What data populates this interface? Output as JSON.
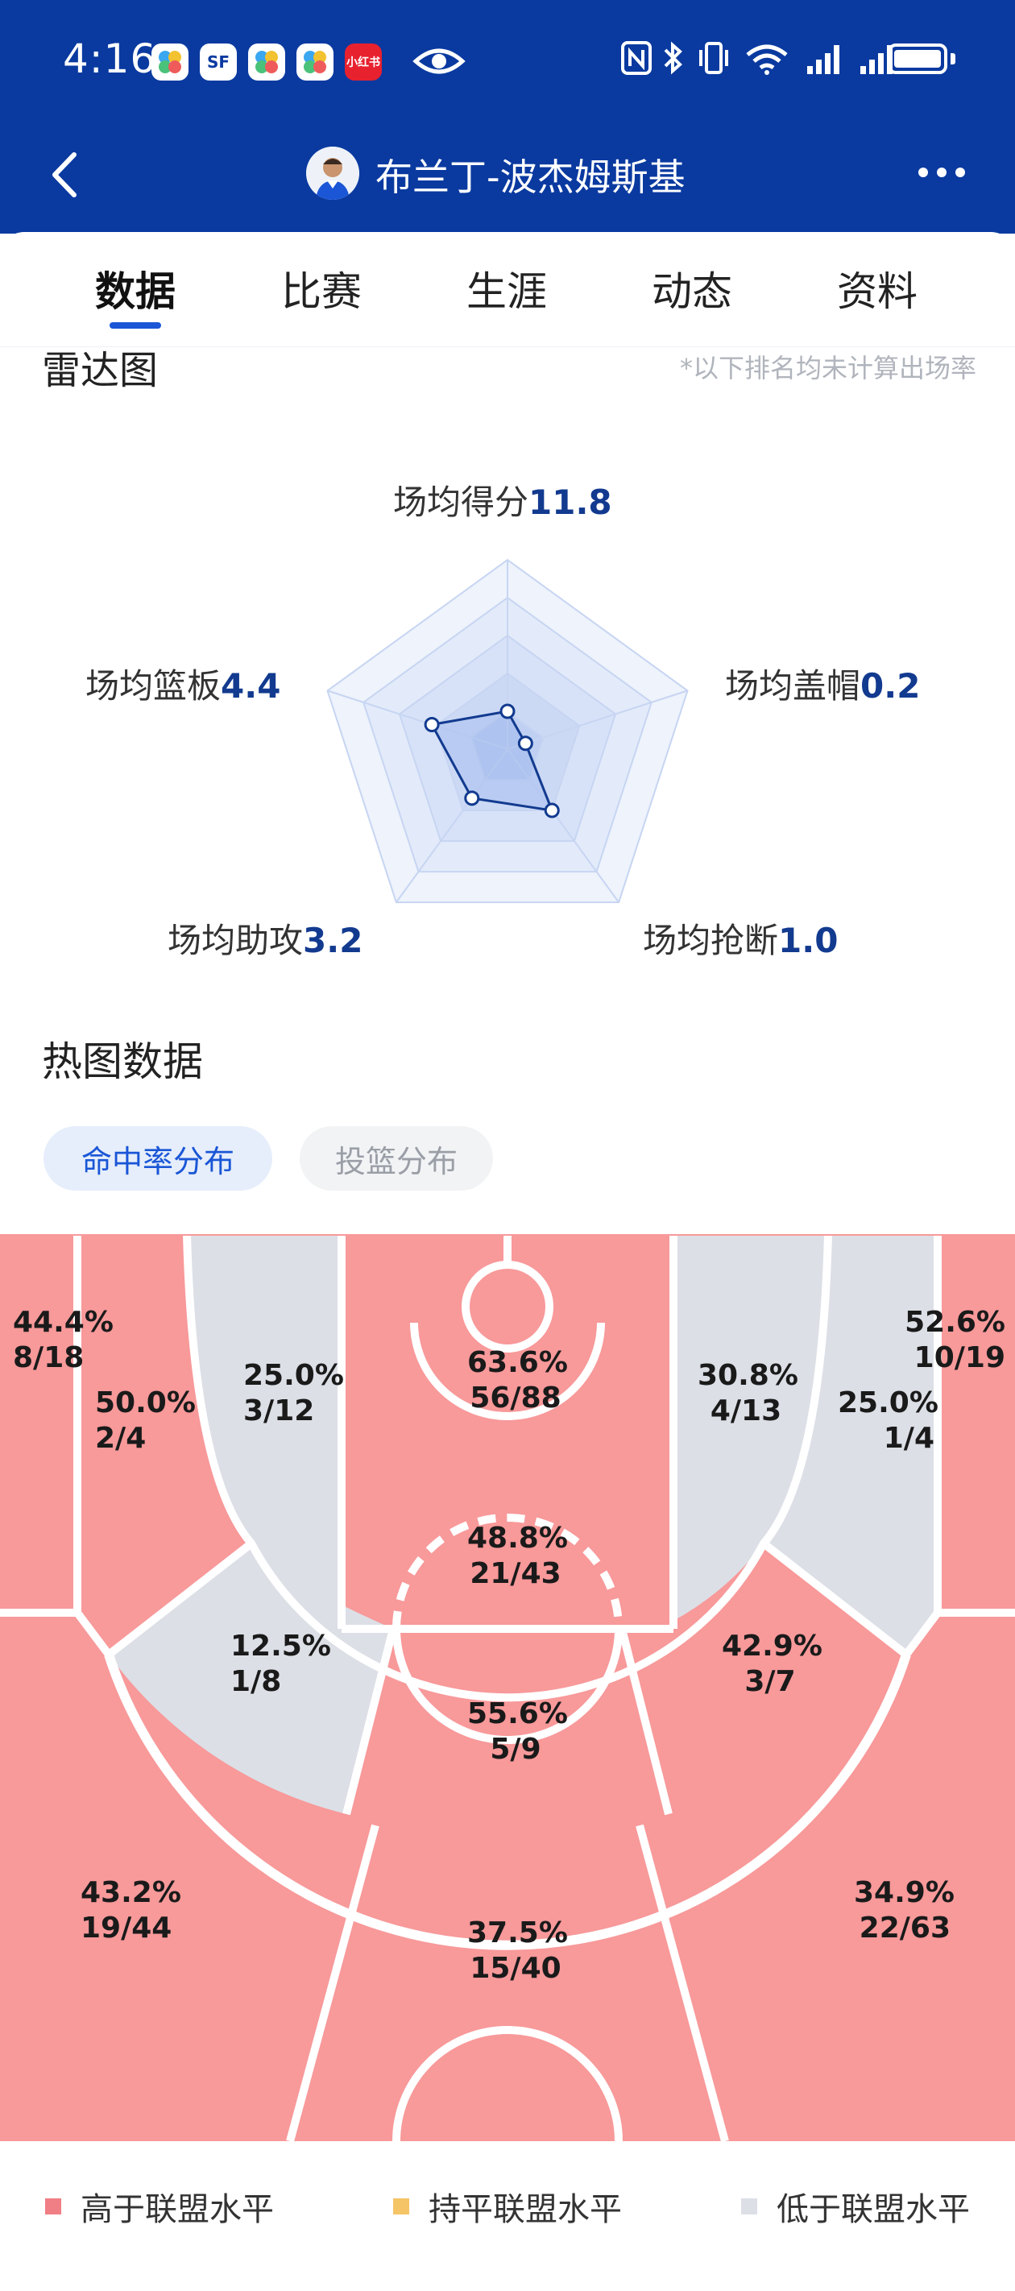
{
  "status_bar": {
    "time": "4:16",
    "app_icons": [
      "SF",
      "小红书"
    ]
  },
  "nav": {
    "player_name": "布兰丁-波杰姆斯基"
  },
  "tabs": [
    {
      "label": "数据",
      "active": true
    },
    {
      "label": "比赛",
      "active": false
    },
    {
      "label": "生涯",
      "active": false
    },
    {
      "label": "动态",
      "active": false
    },
    {
      "label": "资料",
      "active": false
    }
  ],
  "radar": {
    "title": "雷达图",
    "note": "*以下排名均未计算出场率",
    "axes": [
      {
        "label": "场均得分",
        "value": "11.8",
        "level": 0.2
      },
      {
        "label": "场均盖帽",
        "value": "0.2",
        "level": 0.1
      },
      {
        "label": "场均抢断",
        "value": "1.0",
        "level": 0.4
      },
      {
        "label": "场均助攻",
        "value": "3.2",
        "level": 0.32
      },
      {
        "label": "场均篮板",
        "value": "4.4",
        "level": 0.42
      }
    ]
  },
  "heatmap": {
    "title": "热图数据",
    "tabs": [
      {
        "label": "命中率分布",
        "active": true
      },
      {
        "label": "投篮分布",
        "active": false
      }
    ],
    "zones": [
      {
        "id": "left-corner-three",
        "pct": "44.4%",
        "frac": "8/18",
        "level": "above"
      },
      {
        "id": "left-baseline-mid",
        "pct": "50.0%",
        "frac": "2/4",
        "level": "above"
      },
      {
        "id": "left-elbow-mid",
        "pct": "25.0%",
        "frac": "3/12",
        "level": "below"
      },
      {
        "id": "restricted-area",
        "pct": "63.6%",
        "frac": "56/88",
        "level": "above"
      },
      {
        "id": "paint",
        "pct": "48.8%",
        "frac": "21/43",
        "level": "above"
      },
      {
        "id": "right-elbow-mid",
        "pct": "30.8%",
        "frac": "4/13",
        "level": "below"
      },
      {
        "id": "right-baseline-mid",
        "pct": "25.0%",
        "frac": "1/4",
        "level": "below"
      },
      {
        "id": "right-corner-three",
        "pct": "52.6%",
        "frac": "10/19",
        "level": "above"
      },
      {
        "id": "left-wing-mid",
        "pct": "12.5%",
        "frac": "1/8",
        "level": "below"
      },
      {
        "id": "top-key-mid",
        "pct": "55.6%",
        "frac": "5/9",
        "level": "above"
      },
      {
        "id": "right-wing-mid",
        "pct": "42.9%",
        "frac": "3/7",
        "level": "above"
      },
      {
        "id": "left-wing-three",
        "pct": "43.2%",
        "frac": "19/44",
        "level": "above"
      },
      {
        "id": "top-three",
        "pct": "37.5%",
        "frac": "15/40",
        "level": "above"
      },
      {
        "id": "right-wing-three",
        "pct": "34.9%",
        "frac": "22/63",
        "level": "above"
      }
    ],
    "legend": [
      {
        "label": "高于联盟水平",
        "color": "#f07f85"
      },
      {
        "label": "持平联盟水平",
        "color": "#f5c466"
      },
      {
        "label": "低于联盟水平",
        "color": "#dcdfe6"
      }
    ],
    "colors": {
      "above": "#f8999a",
      "below": "#dcdfe6",
      "lines": "#ffffff"
    }
  }
}
